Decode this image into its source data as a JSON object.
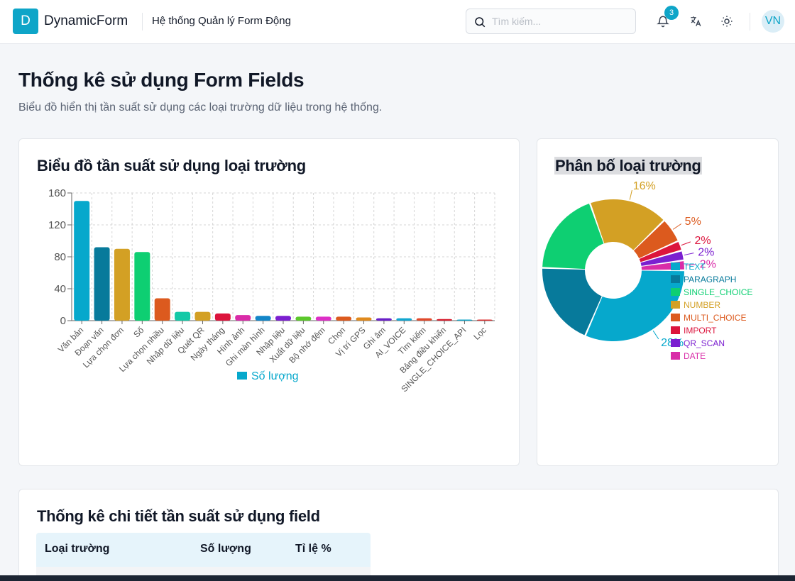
{
  "header": {
    "logo_letter": "D",
    "brand": "DynamicForm",
    "subtitle": "Hệ thống Quản lý Form Động",
    "search_placeholder": "Tìm kiếm...",
    "notification_count": "3",
    "avatar": "VN",
    "icons": [
      "search-icon",
      "bell-icon",
      "translate-icon",
      "sun-icon"
    ]
  },
  "page": {
    "title": "Thống kê sử dụng Form Fields",
    "description": "Biểu đồ hiển thị tần suất sử dụng các loại trường dữ liệu trong hệ thống."
  },
  "bar_card": {
    "title": "Biểu đồ tần suất sử dụng loại trường"
  },
  "pie_card": {
    "title": "Phân bố loại trường"
  },
  "table_card": {
    "title": "Thống kê chi tiết tần suất sử dụng field",
    "columns": [
      "Loại trường",
      "Số lượng",
      "Tỉ lệ %"
    ]
  },
  "chart_data": [
    {
      "type": "bar",
      "categories": [
        "Văn bản",
        "Đoạn văn",
        "Lựa chọn đơn",
        "Số",
        "Lựa chọn nhiều",
        "Nhập dữ liệu",
        "Quét QR",
        "Ngày tháng",
        "Hình ảnh",
        "Ghi màn hình",
        "Nhập liệu",
        "Xuất dữ liệu",
        "Bộ nhớ đệm",
        "Chọn",
        "Vị trí GPS",
        "Ghi âm",
        "AI_VOICE",
        "Tìm kiếm",
        "Bảng điều khiển",
        "SINGLE_CHOICE_API",
        "Lọc"
      ],
      "series": [
        {
          "name": "Số lượng",
          "values": [
            150,
            92,
            90,
            86,
            28,
            11,
            11,
            9,
            7,
            6,
            6,
            5,
            5,
            5,
            4,
            3,
            3,
            3,
            2,
            1,
            1
          ]
        }
      ],
      "colors": [
        "#06a8cc",
        "#077a9b",
        "#d3a024",
        "#0ecf72",
        "#dc5a1e",
        "#14c9a7",
        "#d3a024",
        "#dc143c",
        "#d92ca8",
        "#1386c8",
        "#7b1fd0",
        "#5cc82c",
        "#dd2fc6",
        "#dc5a1e",
        "#e08a1e",
        "#6a20c8",
        "#13a6d0",
        "#e04a2c",
        "#d71e2e",
        "#0fa6c8",
        "#dc2e2e"
      ],
      "ylim": [
        0,
        160
      ],
      "yticks": [
        0,
        40,
        80,
        120,
        160
      ],
      "grid": true,
      "legend": "bottom"
    },
    {
      "type": "pie",
      "variant": "donut",
      "labels": [
        "TEXT",
        "PARAGRAPH",
        "SINGLE_CHOICE",
        "NUMBER",
        "MULTI_CHOICE",
        "IMPORT",
        "QR_SCAN",
        "DATE"
      ],
      "values": [
        28,
        17,
        17,
        16,
        5,
        2,
        2,
        2
      ],
      "label_texts": [
        "28%",
        "",
        "",
        "16%",
        "5%",
        "2%",
        "2%",
        "2%"
      ],
      "colors": [
        "#06a8cc",
        "#077a9b",
        "#0ecf72",
        "#d3a024",
        "#dc5a1e",
        "#dc143c",
        "#7b1fd0",
        "#d92ca8"
      ],
      "legend": "right"
    }
  ]
}
